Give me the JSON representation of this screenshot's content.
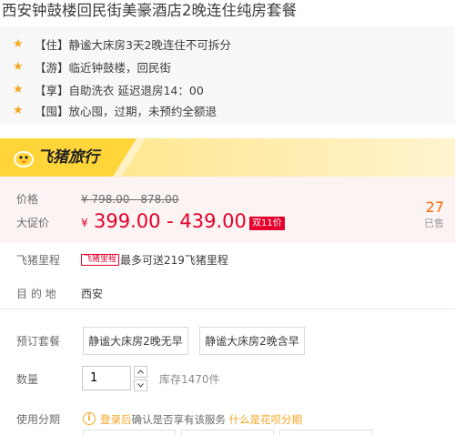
{
  "title": "西安钟鼓楼回民街美豪酒店2晚连住纯房套餐",
  "features": [
    {
      "icon": "star-icon",
      "text": "【住】静谧大床房3天2晚连住不可拆分"
    },
    {
      "icon": "star-icon",
      "text": "【游】临近钟鼓楼，回民街"
    },
    {
      "icon": "star-icon",
      "text": "【享】自助洗衣 延迟退房14：00"
    },
    {
      "icon": "star-icon",
      "text": "【囤】放心囤，过期，未预约全额退"
    }
  ],
  "brand": {
    "name": "飞猪旅行",
    "logo_icon": "fliggy-logo-icon"
  },
  "price": {
    "label": "价格",
    "original": "¥ 798.00 - 878.00",
    "promo_label": "大促价",
    "currency": "¥",
    "promo": "399.00 - 439.00",
    "promo_tag": "双11价",
    "sold_count": "27",
    "sold_label": "已售"
  },
  "mileage": {
    "label": "飞猪里程",
    "tag": "飞猪里程",
    "text": "最多可送219飞猪里程"
  },
  "destination": {
    "label": "目 的 地",
    "value": "西安"
  },
  "package": {
    "label": "预订套餐",
    "options": [
      "静谧大床房2晚无早",
      "静谧大床房2晚含早"
    ]
  },
  "quantity": {
    "label": "数量",
    "value": "1",
    "stock": "库存1470件"
  },
  "installment": {
    "label": "使用分期",
    "link_login": "登录后",
    "text": "确认是否享有该服务",
    "link_huabei": "什么是花呗分期"
  },
  "colors": {
    "accent_red": "#e4002b",
    "brand_yellow": "#ffd53a",
    "star_orange": "#f5a623",
    "sold_orange": "#ff6a00"
  }
}
